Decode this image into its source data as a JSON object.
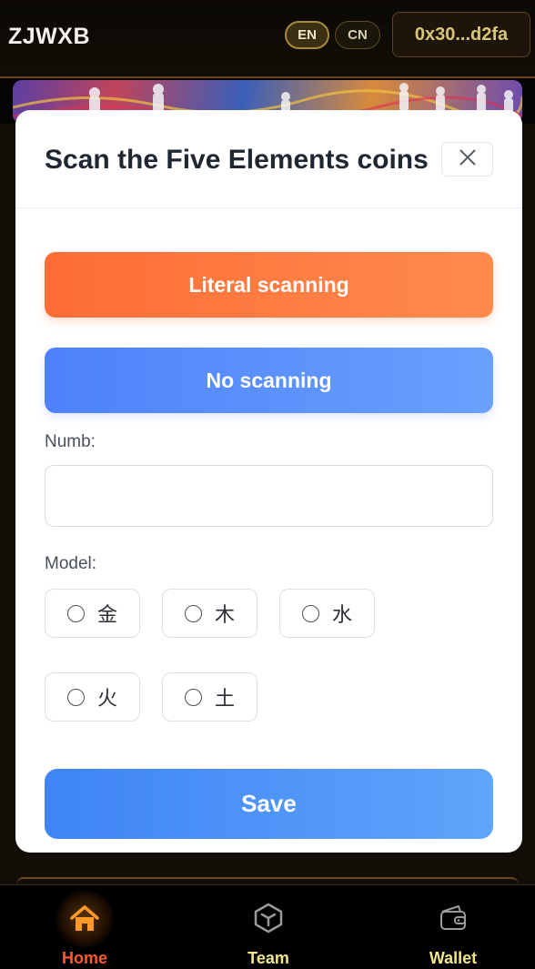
{
  "header": {
    "brand": "ZJWXB",
    "lang_en": "EN",
    "lang_cn": "CN",
    "wallet_address": "0x30...d2fa"
  },
  "modal": {
    "title": "Scan the Five Elements coins",
    "literal_button": "Literal scanning",
    "no_scan_button": "No scanning",
    "numb_label": "Numb:",
    "numb_value": "",
    "numb_placeholder": "",
    "model_label": "Model:",
    "models": [
      "金",
      "木",
      "水",
      "火",
      "土"
    ],
    "save_button": "Save"
  },
  "nav": {
    "items": [
      {
        "label": "Home",
        "icon": "home-icon",
        "active": true
      },
      {
        "label": "Team",
        "icon": "cube-icon",
        "active": false
      },
      {
        "label": "Wallet",
        "icon": "wallet-icon",
        "active": false
      }
    ]
  },
  "colors": {
    "primary_orange": "#ff6d36",
    "primary_blue": "#4d82fb",
    "nav_active": "#ff5a2e",
    "nav_inactive": "#f2e58a"
  }
}
